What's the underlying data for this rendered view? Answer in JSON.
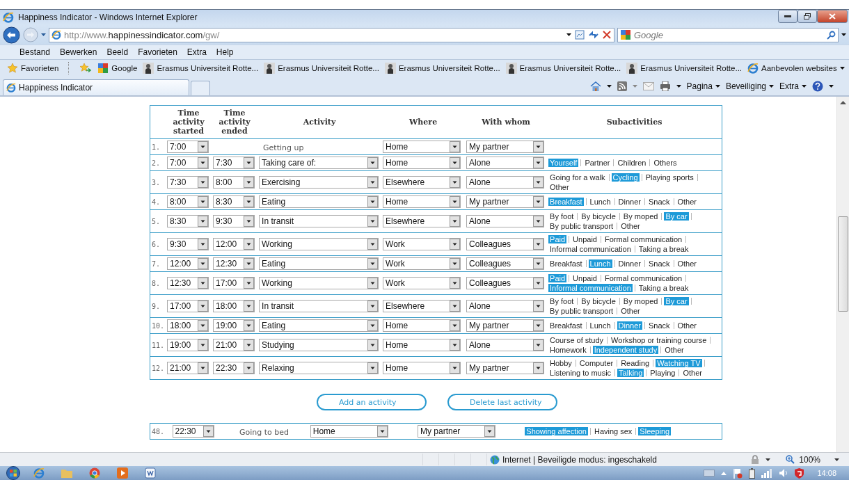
{
  "window": {
    "title": "Happiness Indicator - Windows Internet Explorer"
  },
  "address_bar": {
    "url_prefix": "http://www.",
    "url_host": "happinessindicator.com",
    "url_path": "/gw/"
  },
  "search": {
    "placeholder": "Google"
  },
  "menu": [
    "Bestand",
    "Bewerken",
    "Beeld",
    "Favorieten",
    "Extra",
    "Help"
  ],
  "favorites_bar": {
    "label": "Favorieten",
    "links": [
      {
        "label": "Google",
        "kind": "google"
      },
      {
        "label": "Erasmus Universiteit Rotte...",
        "kind": "page"
      },
      {
        "label": "Erasmus Universiteit Rotte...",
        "kind": "page"
      },
      {
        "label": "Erasmus Universiteit Rotte...",
        "kind": "page"
      },
      {
        "label": "Erasmus Universiteit Rotte...",
        "kind": "page"
      },
      {
        "label": "Erasmus Universiteit Rotte...",
        "kind": "page"
      },
      {
        "label": "Aanbevolen websites",
        "kind": "menu"
      }
    ]
  },
  "tabs": [
    {
      "label": "Happiness Indicator",
      "selected": true
    }
  ],
  "command_bar": [
    "Pagina",
    "Beveiliging",
    "Extra"
  ],
  "table": {
    "columns": [
      "Time activity started",
      "Time activity ended",
      "Activity",
      "Where",
      "With whom",
      "Subactivities"
    ],
    "rows": [
      {
        "number": "1.",
        "start": "7:00",
        "activity": "Getting up",
        "kind": "fixed",
        "where": "Home",
        "with_whom": "My partner"
      },
      {
        "number": "2.",
        "start": "7:00",
        "end": "7:30",
        "activity": "Taking care of:",
        "kind": "editable",
        "where": "Home",
        "with_whom": "Alone",
        "subactivities": [
          {
            "label": "Yourself",
            "selected": true
          },
          {
            "label": "Partner",
            "selected": false
          },
          {
            "label": "Children",
            "selected": false
          },
          {
            "label": "Others",
            "selected": false
          }
        ]
      },
      {
        "number": "3.",
        "start": "7:30",
        "end": "8:00",
        "activity": "Exercising",
        "kind": "editable",
        "where": "Elsewhere",
        "with_whom": "Alone",
        "subactivities": [
          {
            "label": "Going for a walk",
            "selected": false
          },
          {
            "label": "Cycling",
            "selected": true
          },
          {
            "label": "Playing sports",
            "selected": false
          },
          {
            "label": "Other",
            "selected": false
          }
        ]
      },
      {
        "number": "4.",
        "start": "8:00",
        "end": "8:30",
        "activity": "Eating",
        "kind": "editable",
        "where": "Home",
        "with_whom": "My partner",
        "subactivities": [
          {
            "label": "Breakfast",
            "selected": true
          },
          {
            "label": "Lunch",
            "selected": false
          },
          {
            "label": "Dinner",
            "selected": false
          },
          {
            "label": "Snack",
            "selected": false
          },
          {
            "label": "Other",
            "selected": false
          }
        ]
      },
      {
        "number": "5.",
        "start": "8:30",
        "end": "9:30",
        "activity": "In transit",
        "kind": "editable",
        "where": "Elsewhere",
        "with_whom": "Alone",
        "subactivities": [
          {
            "label": "By foot",
            "selected": false
          },
          {
            "label": "By bicycle",
            "selected": false
          },
          {
            "label": "By moped",
            "selected": false
          },
          {
            "label": "By car",
            "selected": true
          },
          {
            "label": "By public transport",
            "selected": false
          },
          {
            "label": "Other",
            "selected": false
          }
        ]
      },
      {
        "number": "6.",
        "start": "9:30",
        "end": "12:00",
        "activity": "Working",
        "kind": "editable",
        "where": "Work",
        "with_whom": "Colleagues",
        "subactivities": [
          {
            "label": "Paid",
            "selected": true
          },
          {
            "label": "Unpaid",
            "selected": false
          },
          {
            "label": "Formal communication",
            "selected": false
          },
          {
            "label": "Informal communication",
            "selected": false
          },
          {
            "label": "Taking a break",
            "selected": false
          }
        ]
      },
      {
        "number": "7.",
        "start": "12:00",
        "end": "12:30",
        "activity": "Eating",
        "kind": "editable",
        "where": "Work",
        "with_whom": "Colleagues",
        "subactivities": [
          {
            "label": "Breakfast",
            "selected": false
          },
          {
            "label": "Lunch",
            "selected": true
          },
          {
            "label": "Dinner",
            "selected": false
          },
          {
            "label": "Snack",
            "selected": false
          },
          {
            "label": "Other",
            "selected": false
          }
        ]
      },
      {
        "number": "8.",
        "start": "12:30",
        "end": "17:00",
        "activity": "Working",
        "kind": "editable",
        "where": "Work",
        "with_whom": "Colleagues",
        "subactivities": [
          {
            "label": "Paid",
            "selected": true
          },
          {
            "label": "Unpaid",
            "selected": false
          },
          {
            "label": "Formal communication",
            "selected": false
          },
          {
            "label": "Informal communication",
            "selected": true
          },
          {
            "label": "Taking a break",
            "selected": false
          }
        ]
      },
      {
        "number": "9.",
        "start": "17:00",
        "end": "18:00",
        "activity": "In transit",
        "kind": "editable",
        "where": "Elsewhere",
        "with_whom": "Alone",
        "subactivities": [
          {
            "label": "By foot",
            "selected": false
          },
          {
            "label": "By bicycle",
            "selected": false
          },
          {
            "label": "By moped",
            "selected": false
          },
          {
            "label": "By car",
            "selected": true
          },
          {
            "label": "By public transport",
            "selected": false
          },
          {
            "label": "Other",
            "selected": false
          }
        ]
      },
      {
        "number": "10.",
        "start": "18:00",
        "end": "19:00",
        "activity": "Eating",
        "kind": "editable",
        "where": "Home",
        "with_whom": "My partner",
        "subactivities": [
          {
            "label": "Breakfast",
            "selected": false
          },
          {
            "label": "Lunch",
            "selected": false
          },
          {
            "label": "Dinner",
            "selected": true
          },
          {
            "label": "Snack",
            "selected": false
          },
          {
            "label": "Other",
            "selected": false
          }
        ]
      },
      {
        "number": "11.",
        "start": "19:00",
        "end": "21:00",
        "activity": "Studying",
        "kind": "editable",
        "where": "Home",
        "with_whom": "Alone",
        "subactivities": [
          {
            "label": "Course of study",
            "selected": false
          },
          {
            "label": "Workshop or training course",
            "selected": false
          },
          {
            "label": "Homework",
            "selected": false
          },
          {
            "label": "Independent study",
            "selected": true
          },
          {
            "label": "Other",
            "selected": false
          }
        ]
      },
      {
        "number": "12.",
        "start": "21:00",
        "end": "22:30",
        "activity": "Relaxing",
        "kind": "editable",
        "where": "Home",
        "with_whom": "My partner",
        "subactivities": [
          {
            "label": "Hobby",
            "selected": false
          },
          {
            "label": "Computer",
            "selected": false
          },
          {
            "label": "Reading",
            "selected": false
          },
          {
            "label": "Watching TV",
            "selected": true
          },
          {
            "label": "Listening to music",
            "selected": false
          },
          {
            "label": "Talking",
            "selected": true
          },
          {
            "label": "Playing",
            "selected": false
          },
          {
            "label": "Other",
            "selected": false
          }
        ]
      }
    ]
  },
  "buttons": [
    "Add an activity",
    "Delete last activity"
  ],
  "final_row": {
    "number": "48.",
    "start": "22:30",
    "activity": "Going to bed",
    "kind": "fixed",
    "where": "Home",
    "with_whom": "My partner",
    "subactivities": [
      {
        "label": "Showing affection",
        "selected": true
      },
      {
        "label": "Having sex",
        "selected": false
      },
      {
        "label": "Sleeping",
        "selected": true
      }
    ]
  },
  "status_bar": {
    "zone": "Internet | Beveiligde modus: ingeschakeld",
    "zoom": "100%"
  },
  "taskbar": {
    "clock": "14:08"
  }
}
